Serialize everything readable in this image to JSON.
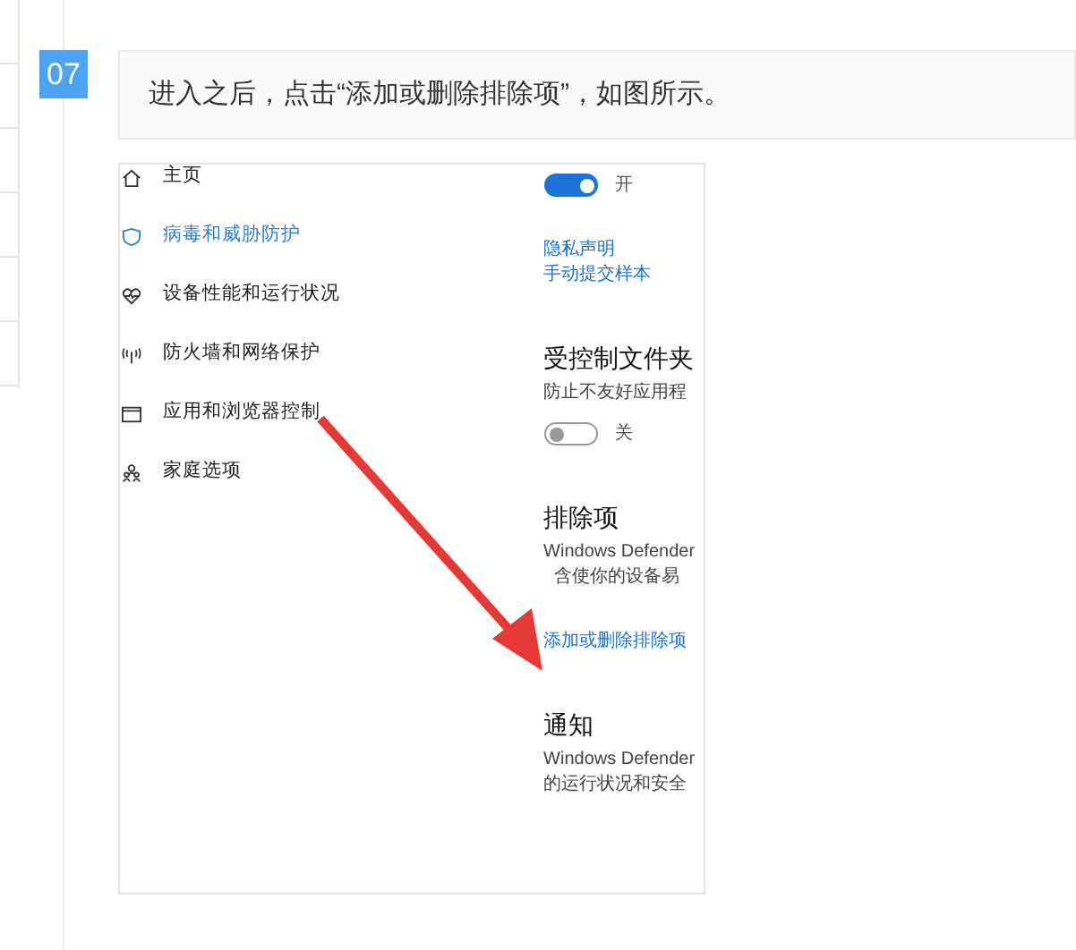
{
  "step": {
    "number": "07",
    "instruction": "进入之后，点击“添加或删除排除项”，如图所示。"
  },
  "screenshot": {
    "nav_items": [
      {
        "label": "主页",
        "selected": false
      },
      {
        "label": "病毒和威胁防护",
        "selected": true
      },
      {
        "label": "设备性能和运行状况",
        "selected": false
      },
      {
        "label": "防火墙和网络保护",
        "selected": false
      },
      {
        "label": "应用和浏览器控制",
        "selected": false
      },
      {
        "label": "家庭选项",
        "selected": false
      }
    ],
    "right_panel": [
      {
        "kind": "toggle",
        "label": "开",
        "on": true
      },
      {
        "kind": "links",
        "items": [
          "隐私声明",
          "手动提交样本"
        ]
      },
      {
        "kind": "heading",
        "text": "受控制文件夹"
      },
      {
        "kind": "text",
        "lines": [
          "防止不友好应用程"
        ]
      },
      {
        "kind": "toggle",
        "label": "关",
        "on": false
      },
      {
        "kind": "heading",
        "text": "排除项"
      },
      {
        "kind": "text",
        "lines": [
          "Windows Defender",
          "含使你的设备易"
        ]
      },
      {
        "kind": "links",
        "items": [
          "添加或删除排除项"
        ]
      },
      {
        "kind": "heading",
        "text": "通知"
      },
      {
        "kind": "text",
        "lines": [
          "Windows Defender",
          "的运行状况和安全"
        ]
      }
    ]
  }
}
